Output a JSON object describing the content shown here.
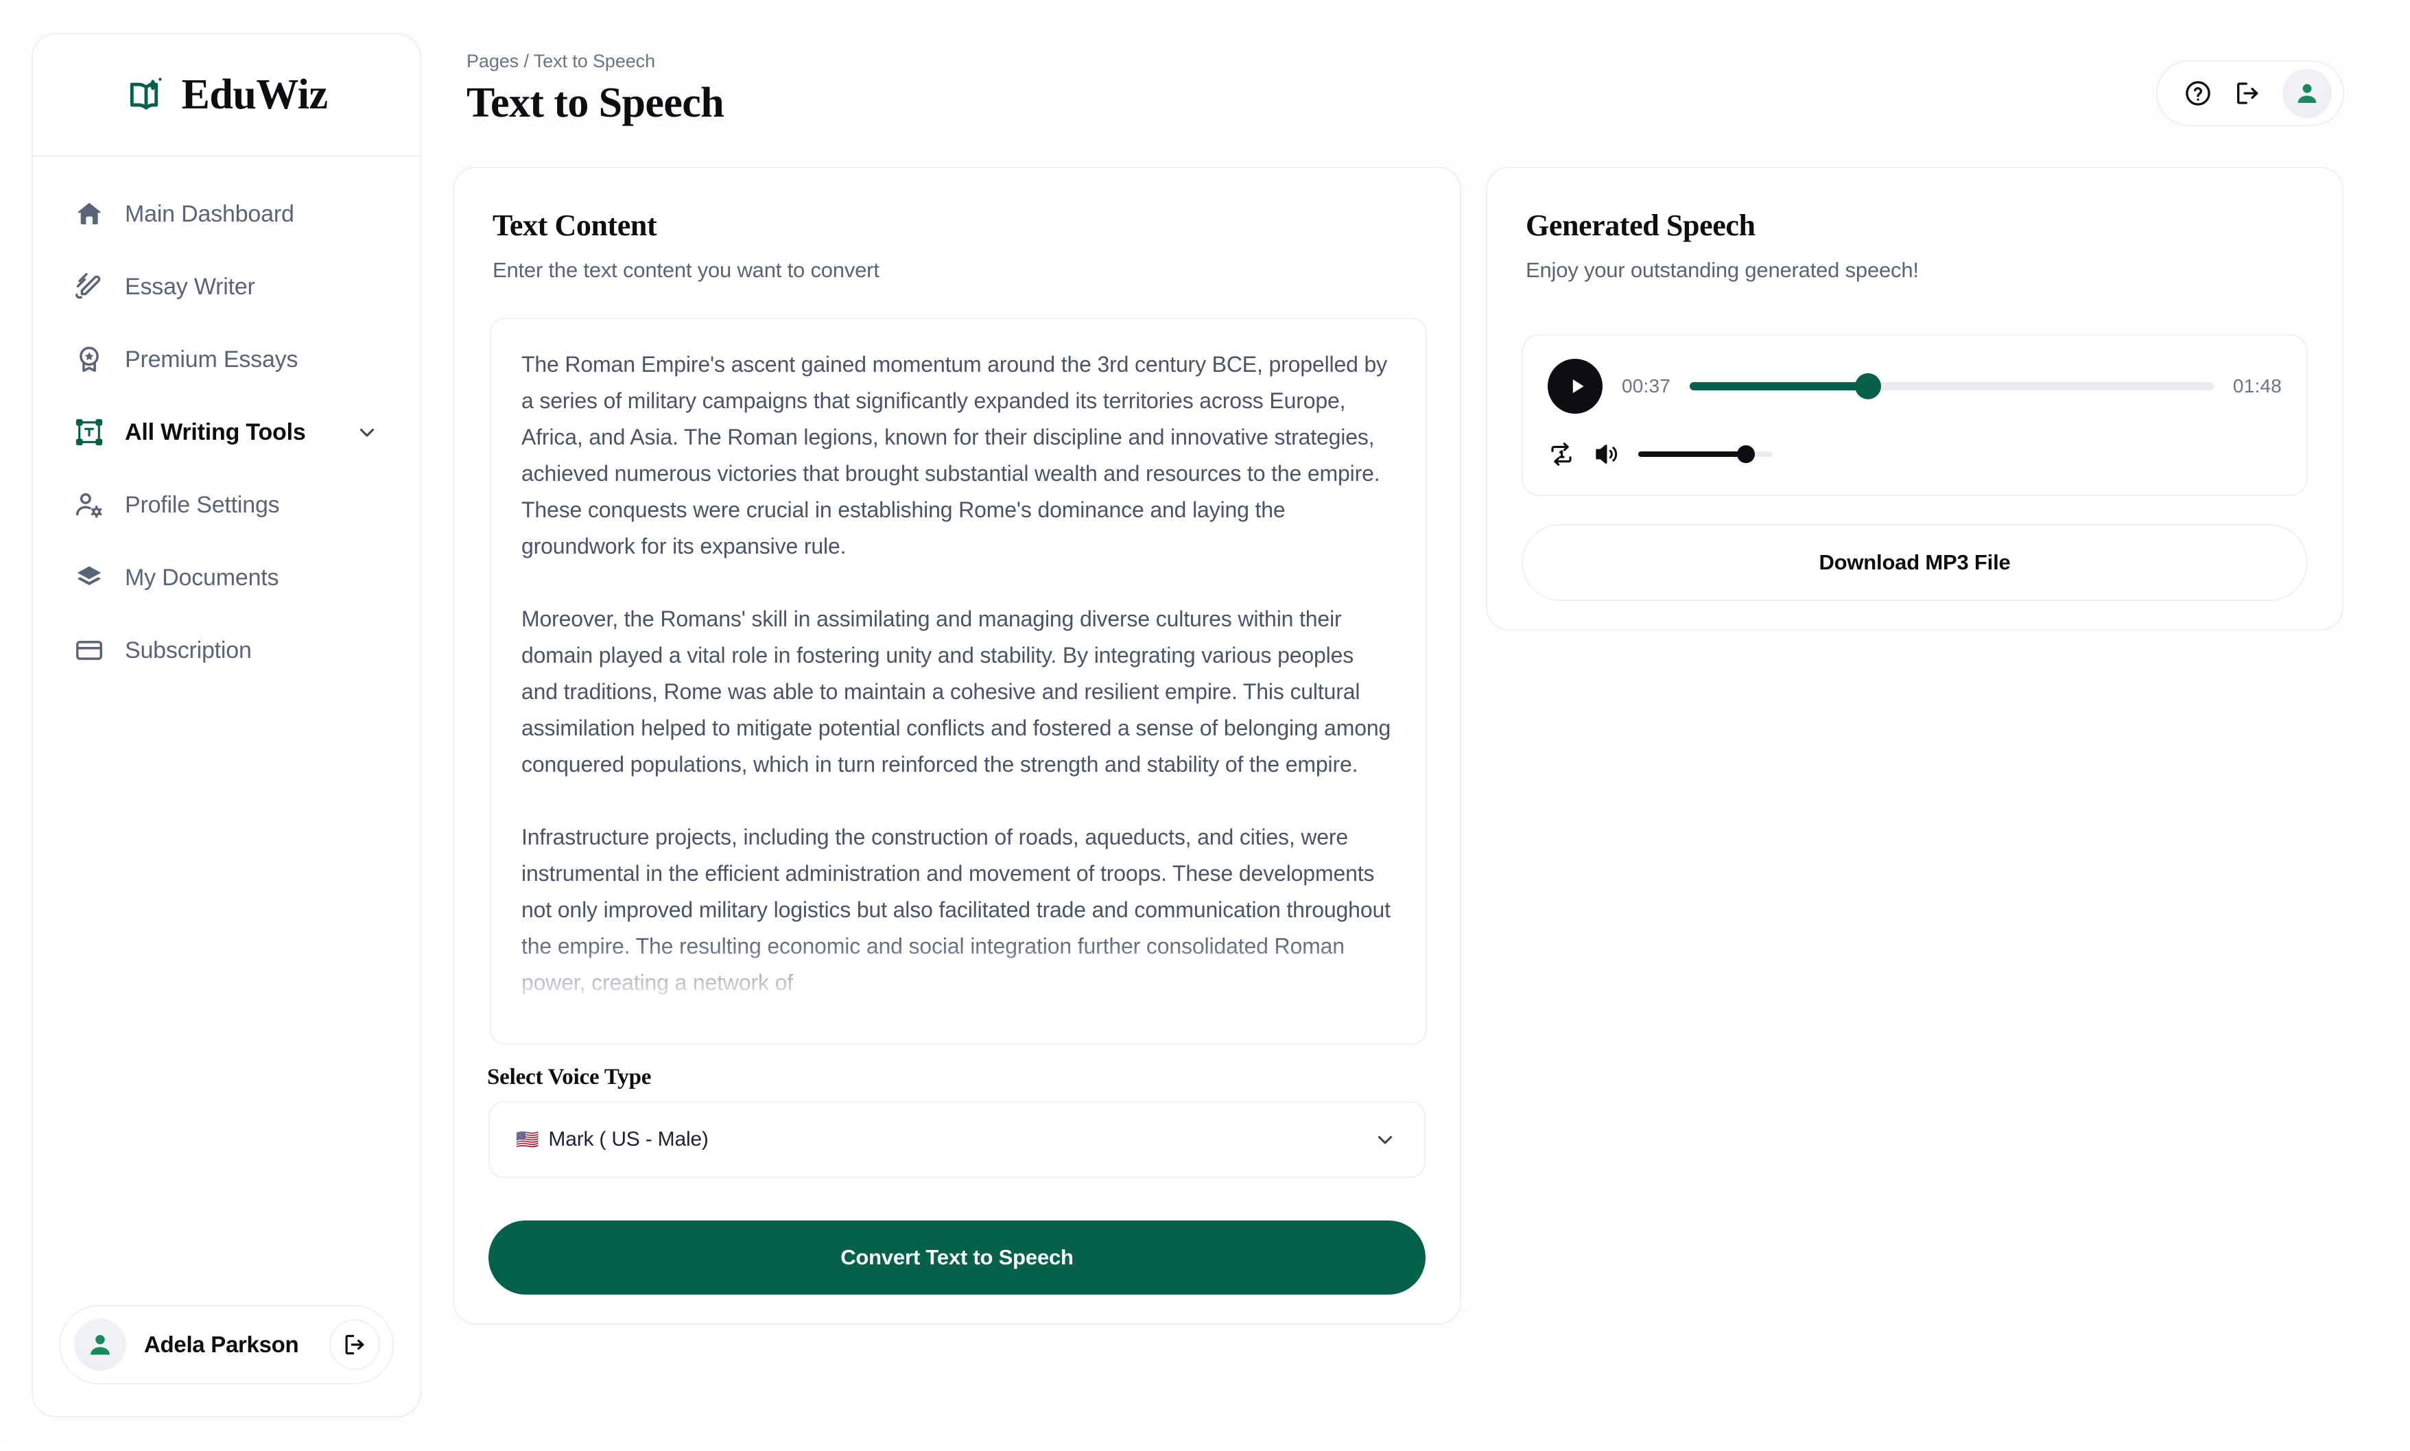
{
  "brand": {
    "name": "EduWiz",
    "logo_icon": "open-book-sparkle-icon",
    "accent_color": "#07614a"
  },
  "header": {
    "breadcrumb": "Pages / Text to Speech",
    "title": "Text to Speech",
    "actions": {
      "help_icon": "question-circle-icon",
      "logout_icon": "logout-arrow-icon",
      "avatar_icon": "user-avatar-icon"
    }
  },
  "sidebar": {
    "items": [
      {
        "label": "Main Dashboard",
        "icon": "home-icon",
        "active": false
      },
      {
        "label": "Essay Writer",
        "icon": "pencil-lines-icon",
        "active": false
      },
      {
        "label": "Premium Essays",
        "icon": "award-star-icon",
        "active": false
      },
      {
        "label": "All Writing Tools",
        "icon": "text-frame-icon",
        "active": true,
        "chevron": "chevron-down-icon"
      },
      {
        "label": "Profile Settings",
        "icon": "user-gear-icon",
        "active": false
      },
      {
        "label": "My Documents",
        "icon": "layers-icon",
        "active": false
      },
      {
        "label": "Subscription",
        "icon": "credit-card-icon",
        "active": false
      }
    ],
    "user": {
      "name": "Adela Parkson",
      "avatar_icon": "user-avatar-icon",
      "logout_icon": "logout-arrow-icon"
    }
  },
  "text_card": {
    "title": "Text Content",
    "subtitle": "Enter the text content you want to convert",
    "paragraphs": [
      "The Roman Empire's ascent gained momentum around the 3rd century BCE, propelled by a series of military campaigns that significantly expanded its territories across Europe, Africa, and Asia. The Roman legions, known for their discipline and innovative strategies, achieved numerous victories that brought substantial wealth and resources to the empire. These conquests were crucial in establishing Rome's dominance and laying the groundwork for its expansive rule.",
      "Moreover, the Romans' skill in assimilating and managing diverse cultures within their domain played a vital role in fostering unity and stability. By integrating various peoples and traditions, Rome was able to maintain a cohesive and resilient empire. This cultural assimilation helped to mitigate potential conflicts and fostered a sense of belonging among conquered populations, which in turn reinforced the strength and stability of the empire.",
      "Infrastructure projects, including the construction of roads, aqueducts, and cities, were instrumental in the efficient administration and movement of troops. These developments not only improved military logistics but also facilitated trade and communication throughout the empire. The resulting economic and social integration further consolidated Roman power, creating a network of"
    ],
    "voice_label": "Select Voice Type",
    "voice_flag": "🇺🇸",
    "voice_selected": "Mark ( US - Male)",
    "voice_chevron_icon": "chevron-down-icon",
    "convert_button": "Convert Text to Speech"
  },
  "speech_card": {
    "title": "Generated Speech",
    "subtitle": "Enjoy your outstanding generated speech!",
    "player": {
      "play_icon": "play-triangle-icon",
      "current_time": "00:37",
      "total_time": "01:48",
      "progress_percent": 34,
      "repeat_icon": "repeat-one-icon",
      "volume_icon": "speaker-wave-icon",
      "volume_percent": 80,
      "progress_color": "#07614a"
    },
    "download_button": "Download MP3 File"
  }
}
